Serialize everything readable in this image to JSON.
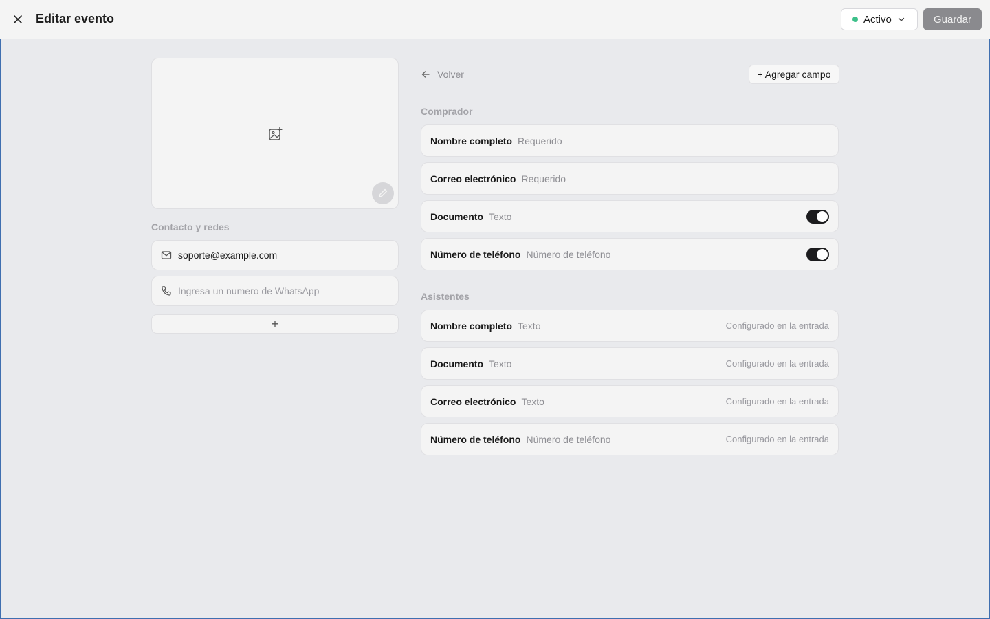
{
  "header": {
    "title": "Editar evento",
    "status": {
      "label": "Activo",
      "dot_color": "#3cc08a"
    },
    "save_label": "Guardar"
  },
  "left": {
    "contact_section_label": "Contacto y redes",
    "email_value": "soporte@example.com",
    "whatsapp_placeholder": "Ingresa un numero de WhatsApp",
    "add_button_glyph": "+"
  },
  "right": {
    "back_label": "Volver",
    "add_field_label": "+ Agregar campo",
    "buyer": {
      "label": "Comprador",
      "fields": [
        {
          "name": "Nombre completo",
          "type": "Requerido"
        },
        {
          "name": "Correo electrónico",
          "type": "Requerido"
        },
        {
          "name": "Documento",
          "type": "Texto",
          "toggle": true
        },
        {
          "name": "Número de teléfono",
          "type": "Número de teléfono",
          "toggle": true
        }
      ]
    },
    "attendees": {
      "label": "Asistentes",
      "fields": [
        {
          "name": "Nombre completo",
          "type": "Texto",
          "note": "Configurado en la entrada"
        },
        {
          "name": "Documento",
          "type": "Texto",
          "note": "Configurado en la entrada"
        },
        {
          "name": "Correo electrónico",
          "type": "Texto",
          "note": "Configurado en la entrada"
        },
        {
          "name": "Número de teléfono",
          "type": "Número de teléfono",
          "note": "Configurado en la entrada"
        }
      ]
    }
  },
  "icons": {
    "close": "close-icon",
    "chevron": "chevron-down-icon",
    "image_add": "image-add-icon",
    "pencil": "pencil-icon",
    "mail": "mail-icon",
    "phone": "phone-icon",
    "arrow_left": "arrow-left-icon"
  }
}
